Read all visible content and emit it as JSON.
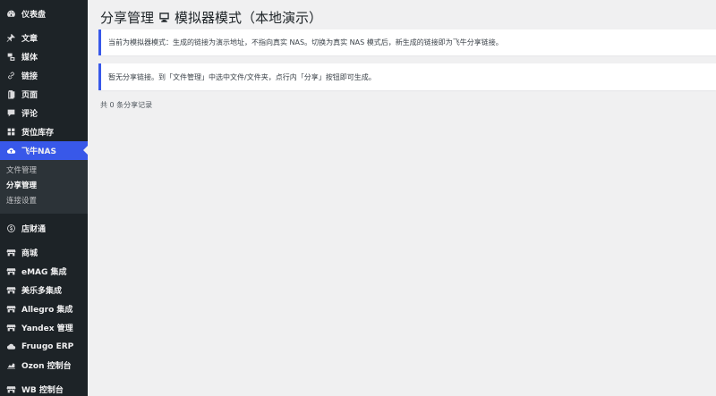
{
  "sidebar": {
    "items": [
      {
        "label": "仪表盘",
        "icon": "dashboard-icon"
      },
      {
        "label": "文章",
        "icon": "pin-icon"
      },
      {
        "label": "媒体",
        "icon": "media-icon"
      },
      {
        "label": "链接",
        "icon": "link-icon"
      },
      {
        "label": "页面",
        "icon": "page-icon"
      },
      {
        "label": "评论",
        "icon": "comment-icon"
      },
      {
        "label": "货位库存",
        "icon": "grid-icon"
      },
      {
        "label": "飞牛NAS",
        "icon": "cloud-icon"
      },
      {
        "label": "店财通",
        "icon": "dollar-icon"
      },
      {
        "label": "商城",
        "icon": "store-icon"
      },
      {
        "label": "eMAG 集成",
        "icon": "store-icon"
      },
      {
        "label": "美乐多集成",
        "icon": "store-icon"
      },
      {
        "label": "Allegro 集成",
        "icon": "store-icon"
      },
      {
        "label": "Yandex 管理",
        "icon": "store-icon"
      },
      {
        "label": "Fruugo ERP",
        "icon": "cloud-icon"
      },
      {
        "label": "Ozon 控制台",
        "icon": "chart-icon"
      },
      {
        "label": "WB 控制台",
        "icon": "store-icon"
      }
    ],
    "submenu": [
      {
        "label": "文件管理"
      },
      {
        "label": "分享管理"
      },
      {
        "label": "连接设置"
      }
    ]
  },
  "main": {
    "title_left": "分享管理",
    "title_right": "模拟器模式（本地演示）",
    "notice_simulator": "当前为模拟器模式：生成的链接为演示地址，不指向真实 NAS。切换为真实 NAS 模式后，新生成的链接即为飞牛分享链接。",
    "notice_empty": "暂无分享链接。到「文件管理」中选中文件/文件夹，点行内「分享」按钮即可生成。",
    "record_count": "共 0 条分享记录"
  },
  "colors": {
    "sidebar_bg": "#1d2327",
    "accent": "#3858e9",
    "page_bg": "#f0f0f1"
  }
}
